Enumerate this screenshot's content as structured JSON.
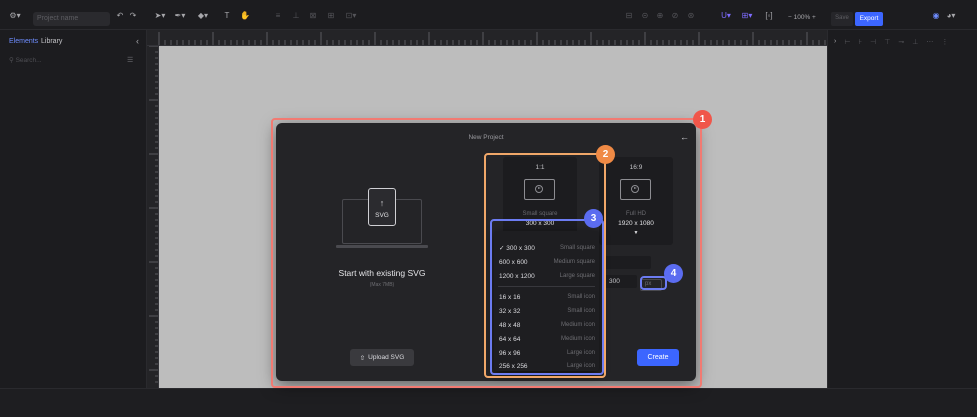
{
  "toolbar": {
    "project_placeholder": "Project name",
    "zoom": "100%",
    "save_label": "Save",
    "export_label": "Export"
  },
  "left_panel": {
    "tabs": [
      "Elements",
      "Library"
    ],
    "search_placeholder": "Search..."
  },
  "modal": {
    "title": "New Project",
    "start": {
      "title": "Start with existing SVG",
      "subtitle": "(Max 7MB)",
      "file_label": "SVG",
      "upload_label": "Upload SVG"
    },
    "cards": [
      {
        "ratio": "1:1",
        "name": "Small square",
        "dims": "300 x 300"
      },
      {
        "ratio": "16:9",
        "name": "Full HD",
        "dims": "1920 x 1080"
      }
    ],
    "custom_height": "300",
    "unit": "px",
    "create_label": "Create"
  },
  "dropdown": {
    "selected_mark": "✓",
    "options": [
      {
        "dims": "300 x 300",
        "label": "Small square"
      },
      {
        "dims": "600 x 600",
        "label": "Medium square"
      },
      {
        "dims": "1200 x 1200",
        "label": "Large square"
      },
      {
        "dims": "16 x 16",
        "label": "Small icon"
      },
      {
        "dims": "32 x 32",
        "label": "Small icon"
      },
      {
        "dims": "48 x 48",
        "label": "Medium icon"
      },
      {
        "dims": "64 x 64",
        "label": "Medium icon"
      },
      {
        "dims": "96 x 96",
        "label": "Large icon"
      },
      {
        "dims": "256 x 256",
        "label": "Large icon"
      }
    ]
  },
  "annotations": [
    {
      "number": "1",
      "color": "#f0564a"
    },
    {
      "number": "2",
      "color": "#f08a45"
    },
    {
      "number": "3",
      "color": "#5b6cf0"
    },
    {
      "number": "4",
      "color": "#5b6cf0"
    }
  ],
  "colors": {
    "accent": "#3c66ff"
  }
}
